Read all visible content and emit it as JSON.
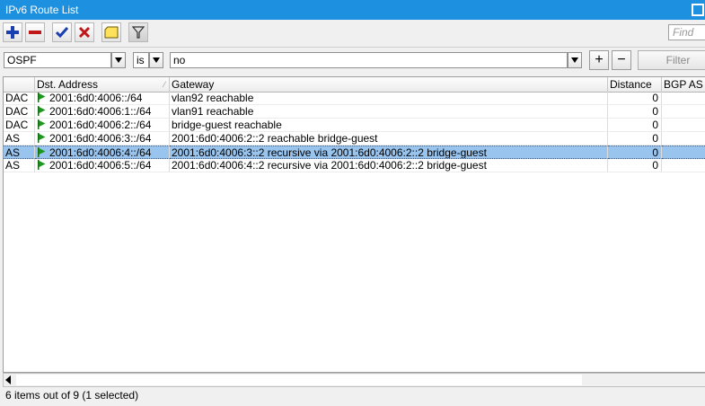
{
  "window": {
    "title": "IPv6 Route List"
  },
  "toolbar": {
    "add_icon": "plus-icon",
    "remove_icon": "minus-icon",
    "enable_icon": "check-icon",
    "disable_icon": "x-icon",
    "comment_icon": "note-icon",
    "filter_icon": "funnel-icon",
    "find_placeholder": "Find"
  },
  "filter": {
    "field": "OSPF",
    "operator": "is",
    "value": "no",
    "add_label": "+",
    "remove_label": "−",
    "filter_label": "Filter"
  },
  "table": {
    "columns": [
      "",
      "Dst. Address",
      "Gateway",
      "Distance",
      "BGP AS P"
    ],
    "rows": [
      {
        "flags": "DAC",
        "dst": "2001:6d0:4006::/64",
        "gateway": "vlan92 reachable",
        "distance": "0",
        "selected": false
      },
      {
        "flags": "DAC",
        "dst": "2001:6d0:4006:1::/64",
        "gateway": "vlan91 reachable",
        "distance": "0",
        "selected": false
      },
      {
        "flags": "DAC",
        "dst": "2001:6d0:4006:2::/64",
        "gateway": "bridge-guest reachable",
        "distance": "0",
        "selected": false
      },
      {
        "flags": "AS",
        "dst": "2001:6d0:4006:3::/64",
        "gateway": "2001:6d0:4006:2::2 reachable bridge-guest",
        "distance": "0",
        "selected": false
      },
      {
        "flags": "AS",
        "dst": "2001:6d0:4006:4::/64",
        "gateway": "2001:6d0:4006:3::2 recursive via 2001:6d0:4006:2::2 bridge-guest",
        "distance": "0",
        "selected": true
      },
      {
        "flags": "AS",
        "dst": "2001:6d0:4006:5::/64",
        "gateway": "2001:6d0:4006:4::2 recursive via 2001:6d0:4006:2::2 bridge-guest",
        "distance": "0",
        "selected": false
      }
    ]
  },
  "status": {
    "text": "6 items out of 9 (1 selected)"
  },
  "colors": {
    "titlebar": "#1e90e0",
    "selection": "#99c4ee",
    "route_flag": "#1a9a1a"
  }
}
